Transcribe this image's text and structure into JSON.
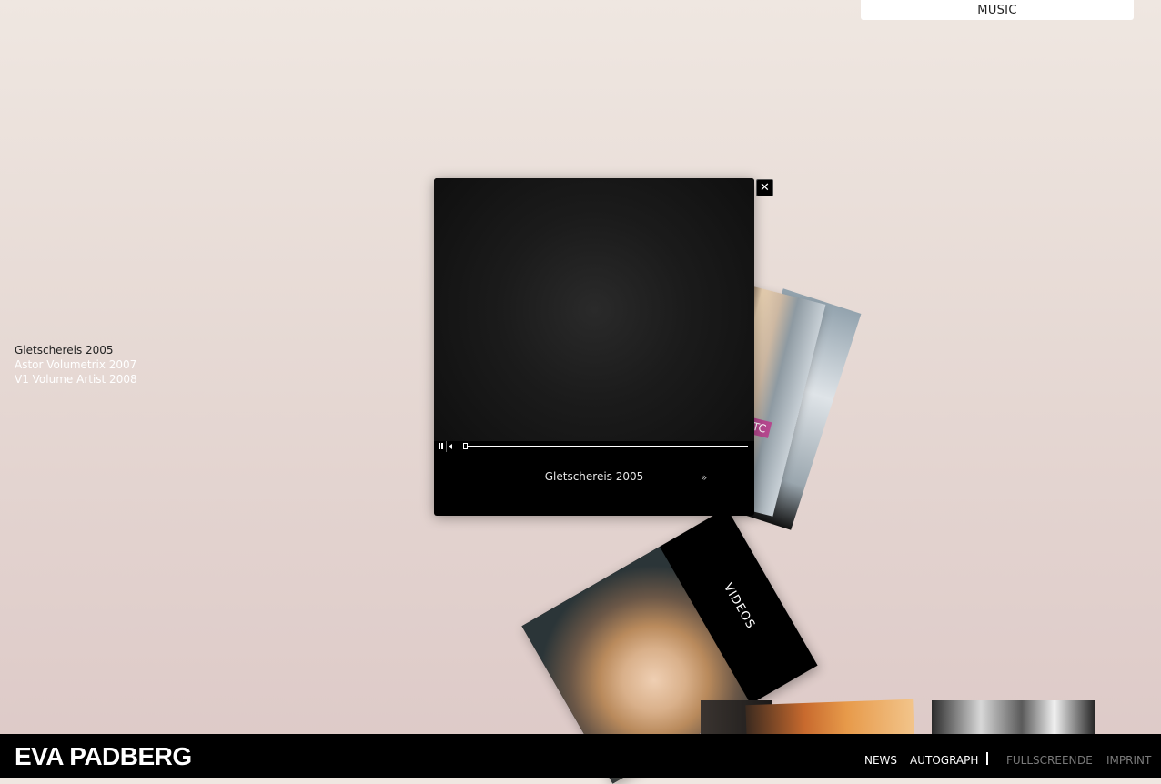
{
  "header": {
    "music_label": "MUSIC"
  },
  "video_list": [
    {
      "label": "Gletschereis 2005",
      "active": true
    },
    {
      "label": "Astor Volumetrix 2007",
      "active": false
    },
    {
      "label": "V1 Volume Artist 2008",
      "active": false
    }
  ],
  "cards": {
    "top_card_text": "TC",
    "videos_label": "VIDEOS"
  },
  "player": {
    "title": "Gletschereis 2005",
    "progress": 0.0
  },
  "footer": {
    "logo": "EVA PADBERG",
    "nav_news": "NEWS",
    "nav_autograph": "AUTOGRAPH",
    "nav_fullscreen": "FULLSCREEN",
    "nav_language": "DE",
    "nav_imprint": "IMPRINT"
  },
  "colors": {
    "accent": "#ffffff",
    "bar": "#000000",
    "muted": "#7a7a7a"
  }
}
